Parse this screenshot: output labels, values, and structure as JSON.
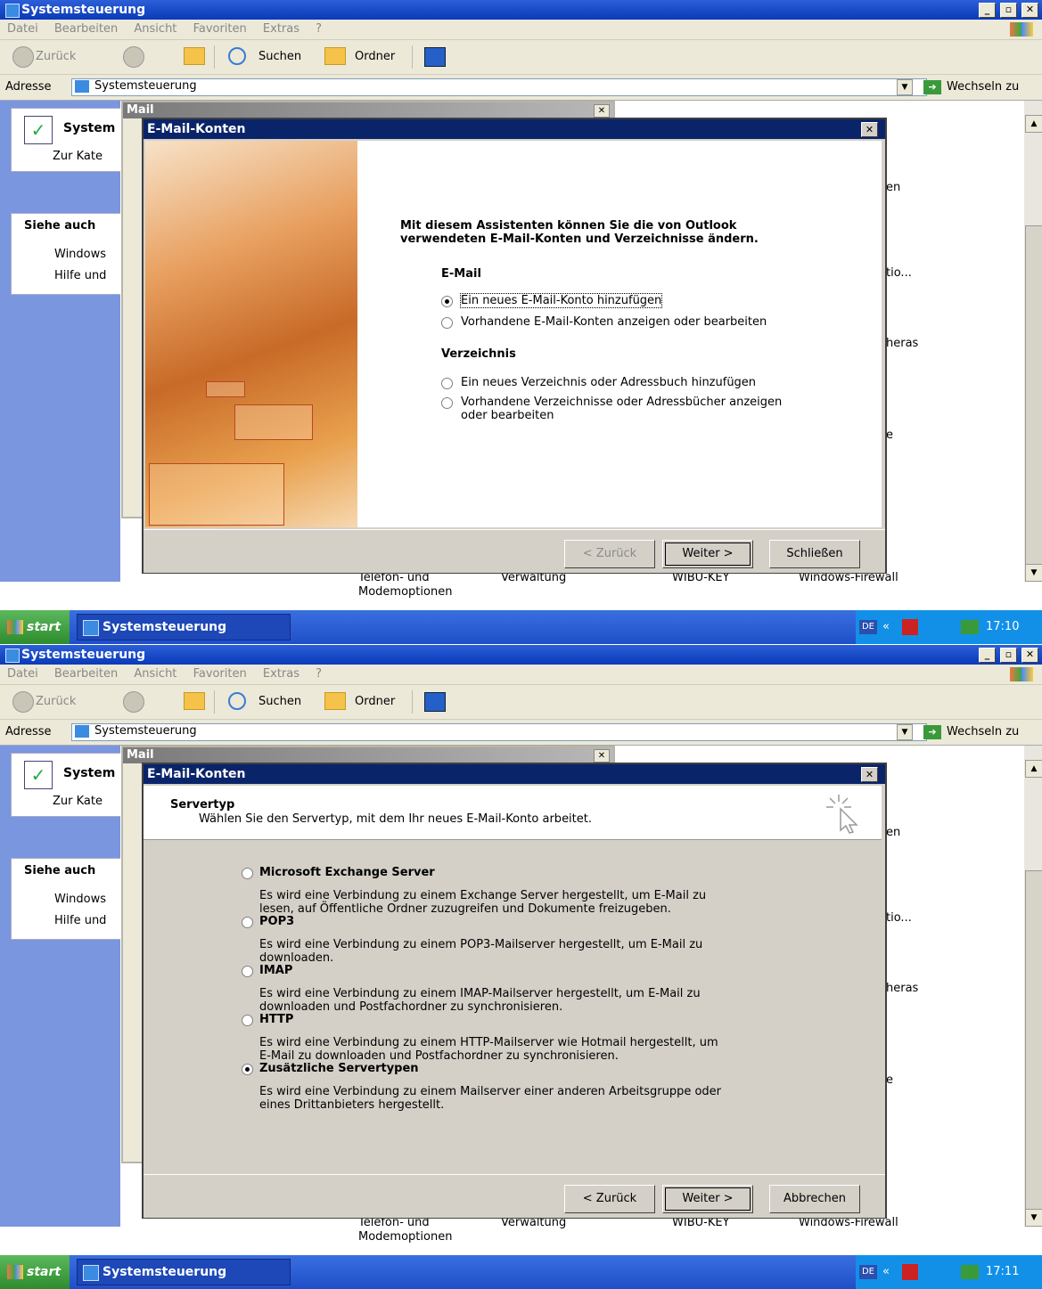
{
  "window": {
    "title": "Systemsteuerung",
    "controls": [
      "_",
      "▫",
      "✕"
    ]
  },
  "menu": [
    "Datei",
    "Bearbeiten",
    "Ansicht",
    "Favoriten",
    "Extras",
    "?"
  ],
  "toolbar": {
    "back": "Zurück",
    "search": "Suchen",
    "folders": "Ordner"
  },
  "address": {
    "label": "Adresse",
    "value": "Systemsteuerung",
    "go": "Wechseln zu"
  },
  "sidebar": {
    "panel1_title": "System",
    "panel1_link": "Zur Kate",
    "see_also_title": "Siehe auch",
    "see_also_items": [
      "Windows",
      "Hilfe und"
    ]
  },
  "content_peek": {
    "right_texts": [
      "en",
      "tio...",
      "heras",
      "e"
    ],
    "bottom_items": [
      "Telefon- und",
      "Modemoptionen",
      "Verwaltung",
      "WIBU-KEY",
      "Windows-Firewall"
    ]
  },
  "mail_window": {
    "title": "Mail",
    "close": "✕"
  },
  "screenshot1": {
    "dialog_title": "E-Mail-Konten",
    "intro_line1": "Mit diesem Assistenten können Sie die von Outlook",
    "intro_line2": "verwendeten E-Mail-Konten und Verzeichnisse ändern.",
    "email_heading": "E-Mail",
    "email_options": [
      {
        "label": "Ein neues E-Mail-Konto hinzufügen",
        "selected": true
      },
      {
        "label": "Vorhandene E-Mail-Konten anzeigen oder bearbeiten",
        "selected": false
      }
    ],
    "dir_heading": "Verzeichnis",
    "dir_options": [
      {
        "label": "Ein neues Verzeichnis oder Adressbuch hinzufügen",
        "selected": false
      },
      {
        "label_line1": "Vorhandene Verzeichnisse oder Adressbücher anzeigen",
        "label_line2": "oder bearbeiten",
        "selected": false
      }
    ],
    "buttons": {
      "back": "< Zurück",
      "next": "Weiter >",
      "close": "Schließen"
    },
    "time": "17:10"
  },
  "screenshot2": {
    "dialog_title": "E-Mail-Konten",
    "header_title": "Servertyp",
    "header_subtitle": "Wählen Sie den Servertyp, mit dem Ihr neues E-Mail-Konto arbeitet.",
    "options": [
      {
        "label": "Microsoft Exchange Server",
        "desc1": "Es wird eine Verbindung zu einem Exchange Server hergestellt, um E-Mail zu",
        "desc2": "lesen, auf Öffentliche Ordner zuzugreifen und Dokumente freizugeben.",
        "selected": false
      },
      {
        "label": "POP3",
        "desc1": "Es wird eine Verbindung zu einem POP3-Mailserver hergestellt, um E-Mail zu",
        "desc2": "downloaden.",
        "selected": false
      },
      {
        "label": "IMAP",
        "desc1": "Es wird eine Verbindung zu einem IMAP-Mailserver hergestellt, um E-Mail zu",
        "desc2": "downloaden und Postfachordner zu synchronisieren.",
        "selected": false
      },
      {
        "label": "HTTP",
        "desc1": "Es wird eine Verbindung zu einem HTTP-Mailserver wie Hotmail hergestellt, um",
        "desc2": "E-Mail zu downloaden und Postfachordner zu synchronisieren.",
        "selected": false
      },
      {
        "label": "Zusätzliche Servertypen",
        "desc1": "Es wird eine Verbindung zu einem Mailserver einer anderen Arbeitsgruppe oder",
        "desc2": "eines Drittanbieters hergestellt.",
        "selected": true
      }
    ],
    "buttons": {
      "back": "< Zurück",
      "next": "Weiter >",
      "cancel": "Abbrechen"
    },
    "time": "17:11"
  },
  "taskbar": {
    "start": "start",
    "item": "Systemsteuerung",
    "lang": "DE",
    "arrows": "«"
  }
}
